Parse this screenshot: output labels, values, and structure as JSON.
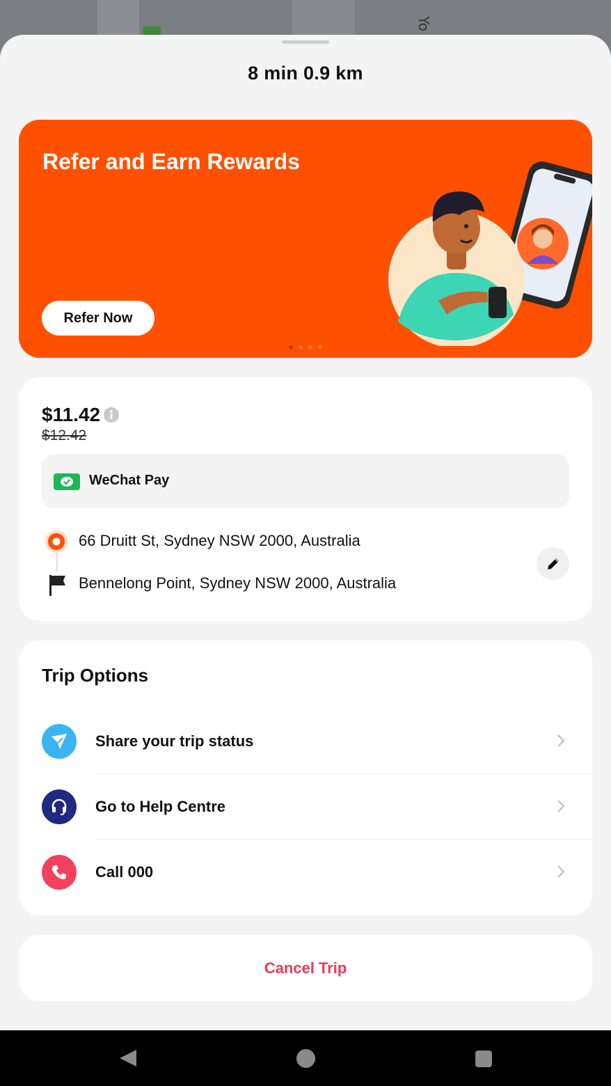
{
  "map": {
    "street_fragment": "Yo"
  },
  "trip": {
    "eta": "8 min  0.9 km"
  },
  "promo": {
    "title": "Refer and Earn Rewards",
    "button_label": "Refer Now",
    "background": "#ff5000",
    "pages": 4,
    "active_page": 1
  },
  "fare": {
    "price": "$11.42",
    "original_price": "$12.42",
    "payment_method": "WeChat Pay",
    "payment_icon": "wechat-pay-icon"
  },
  "route": {
    "pickup": "66 Druitt St, Sydney NSW 2000, Australia",
    "dropoff": "Bennelong Point, Sydney NSW 2000, Australia"
  },
  "trip_options": {
    "title": "Trip Options",
    "items": [
      {
        "label": "Share your trip status",
        "icon": "share-icon",
        "color": "#3bb4f2"
      },
      {
        "label": "Go to Help Centre",
        "icon": "headset-icon",
        "color": "#1f2a80"
      },
      {
        "label": "Call 000",
        "icon": "phone-icon",
        "color": "#f2405e"
      }
    ]
  },
  "actions": {
    "cancel_label": "Cancel Trip",
    "cancel_color": "#ee3a55"
  }
}
